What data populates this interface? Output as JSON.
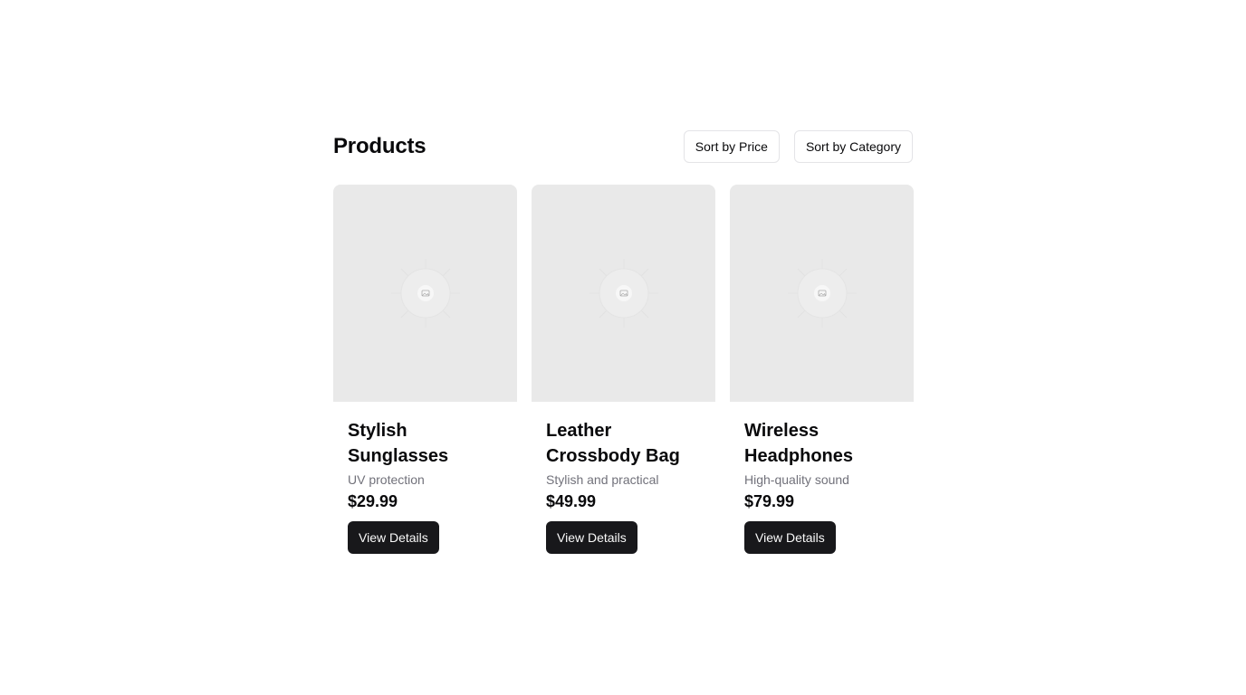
{
  "header": {
    "title": "Products",
    "sort_price_label": "Sort by Price",
    "sort_category_label": "Sort by Category"
  },
  "products": [
    {
      "name": "Stylish Sunglasses",
      "description": "UV protection",
      "price": "$29.99",
      "button_label": "View Details",
      "image_icon": "image-placeholder-icon"
    },
    {
      "name": "Leather Crossbody Bag",
      "description": "Stylish and practical",
      "price": "$49.99",
      "button_label": "View Details",
      "image_icon": "image-placeholder-icon"
    },
    {
      "name": "Wireless Headphones",
      "description": "High-quality sound",
      "price": "$79.99",
      "button_label": "View Details",
      "image_icon": "image-placeholder-icon"
    }
  ],
  "colors": {
    "image_placeholder_bg": "#e9e9e9",
    "primary_button_bg": "#18181b",
    "muted_text": "#71717a"
  }
}
